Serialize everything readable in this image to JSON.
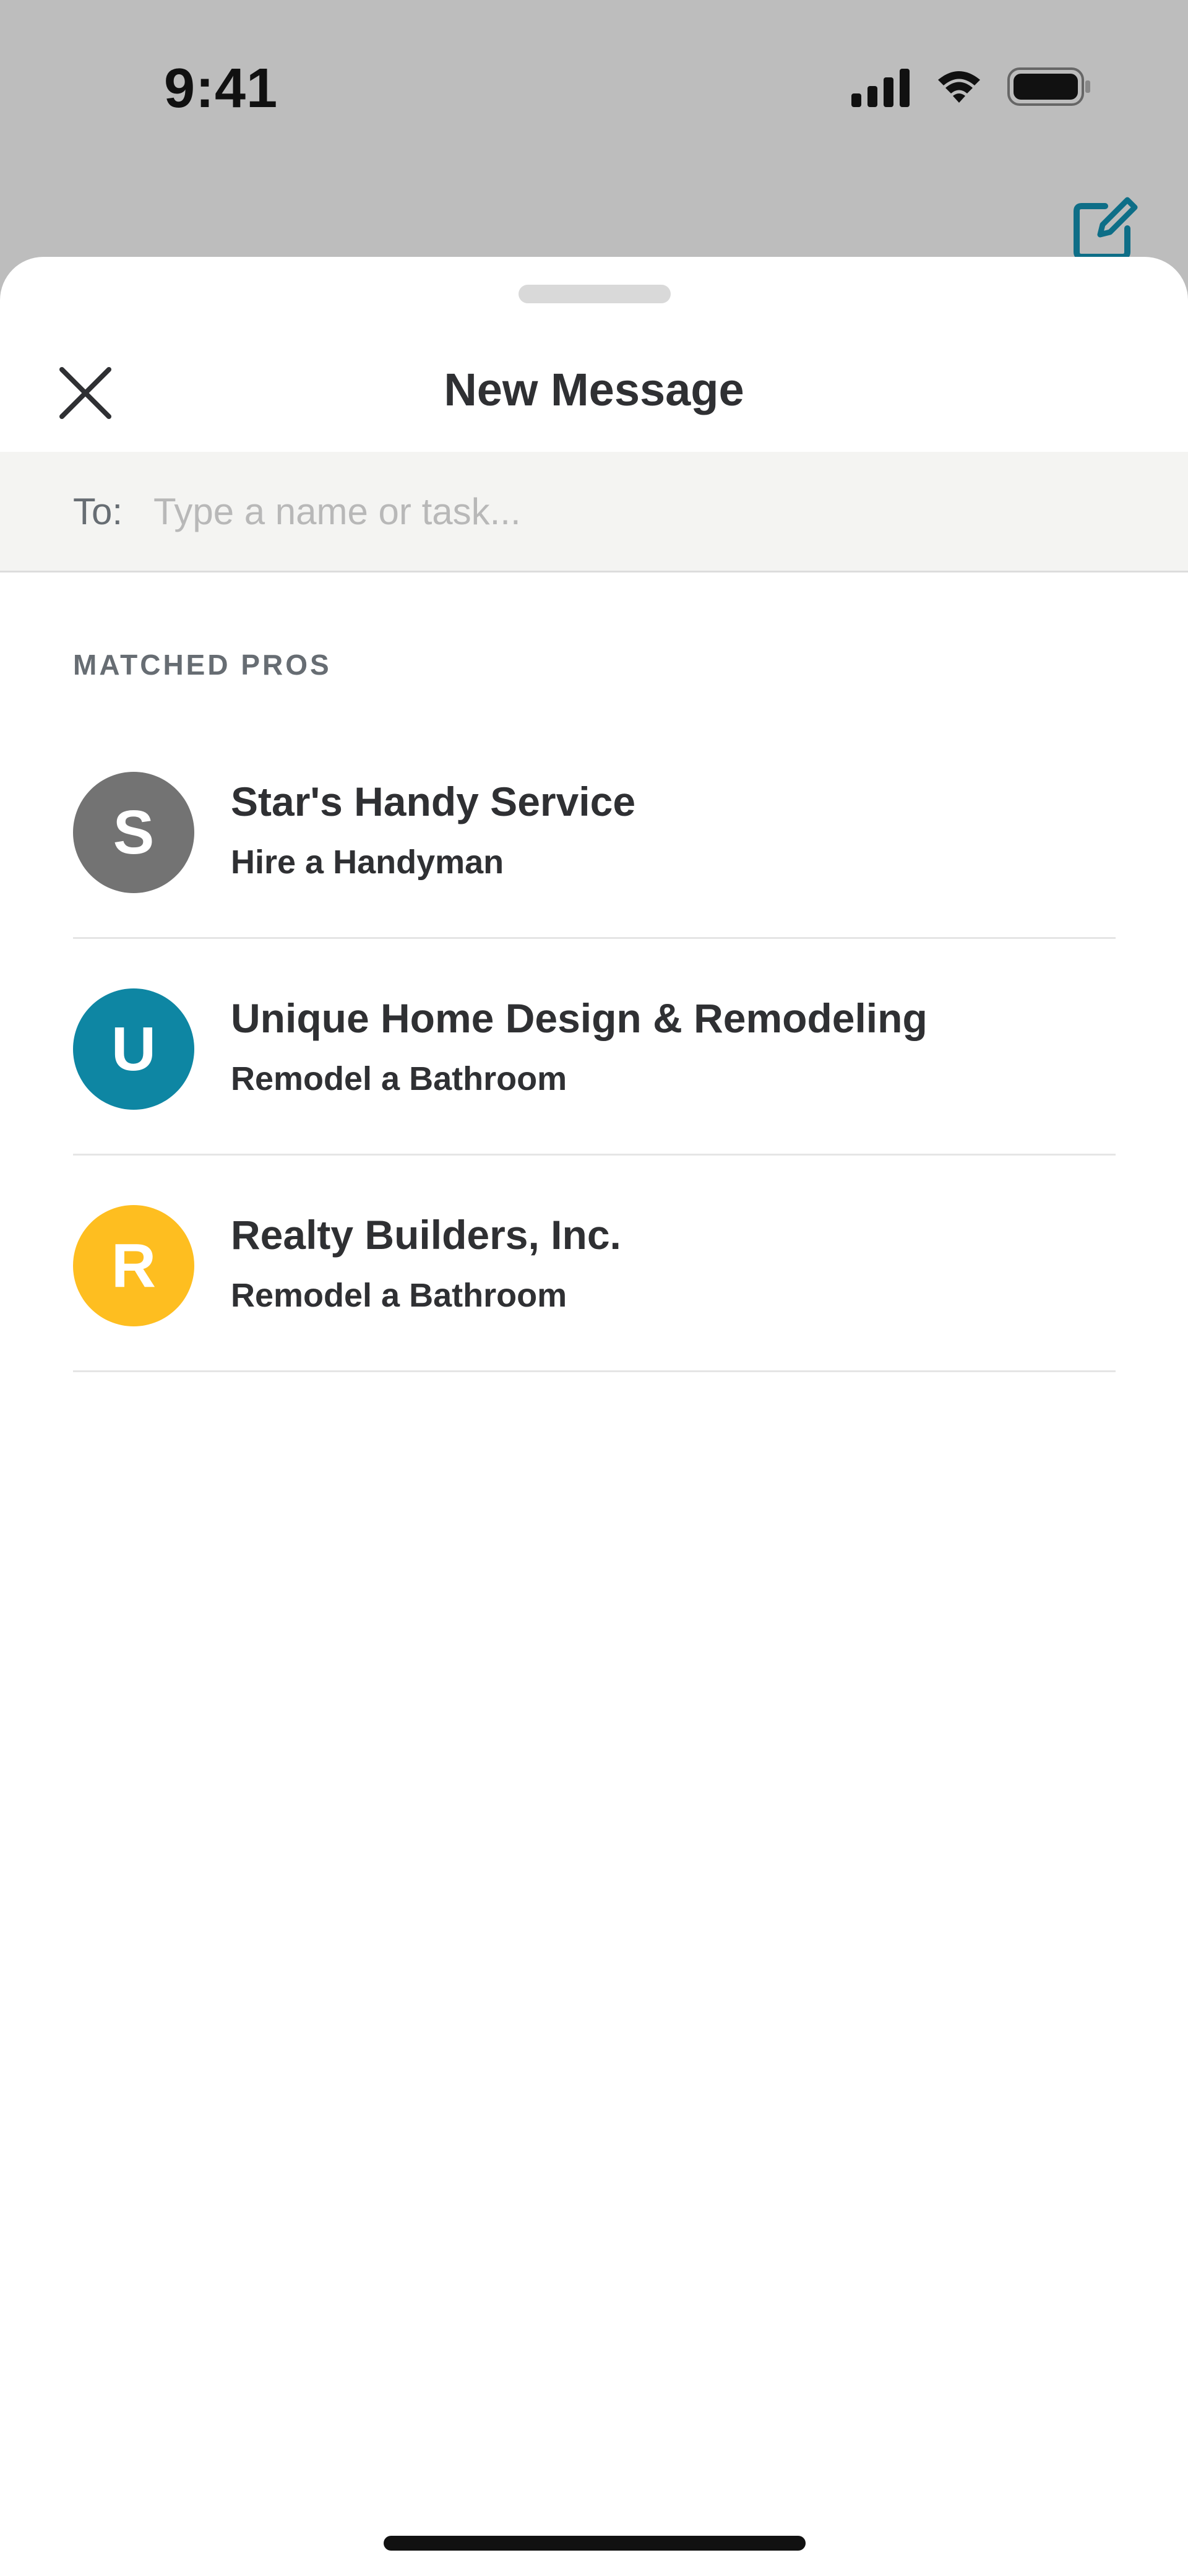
{
  "status_bar": {
    "time": "9:41",
    "icons": [
      "cellular-signal-icon",
      "wifi-icon",
      "battery-icon"
    ]
  },
  "background": {
    "compose_icon": "compose-icon"
  },
  "sheet": {
    "title": "New Message",
    "close_icon": "close-icon"
  },
  "to_field": {
    "label": "To:",
    "value": "",
    "placeholder": "Type a name or task..."
  },
  "matched_pros": {
    "header": "MATCHED PROS",
    "items": [
      {
        "initial": "S",
        "name": "Star's Handy Service",
        "task": "Hire a Handyman",
        "avatar_color": "#737373"
      },
      {
        "initial": "U",
        "name": "Unique Home Design & Remodeling",
        "task": "Remodel a Bathroom",
        "avatar_color": "#0e86a3"
      },
      {
        "initial": "R",
        "name": "Realty Builders, Inc.",
        "task": "Remodel a Bathroom",
        "avatar_color": "#febe20"
      }
    ]
  },
  "colors": {
    "backdrop": "#bdbdbd",
    "accent": "#0e6e87",
    "text_primary": "#2f3033",
    "text_secondary": "#676d73",
    "input_bg": "#f4f4f2"
  }
}
